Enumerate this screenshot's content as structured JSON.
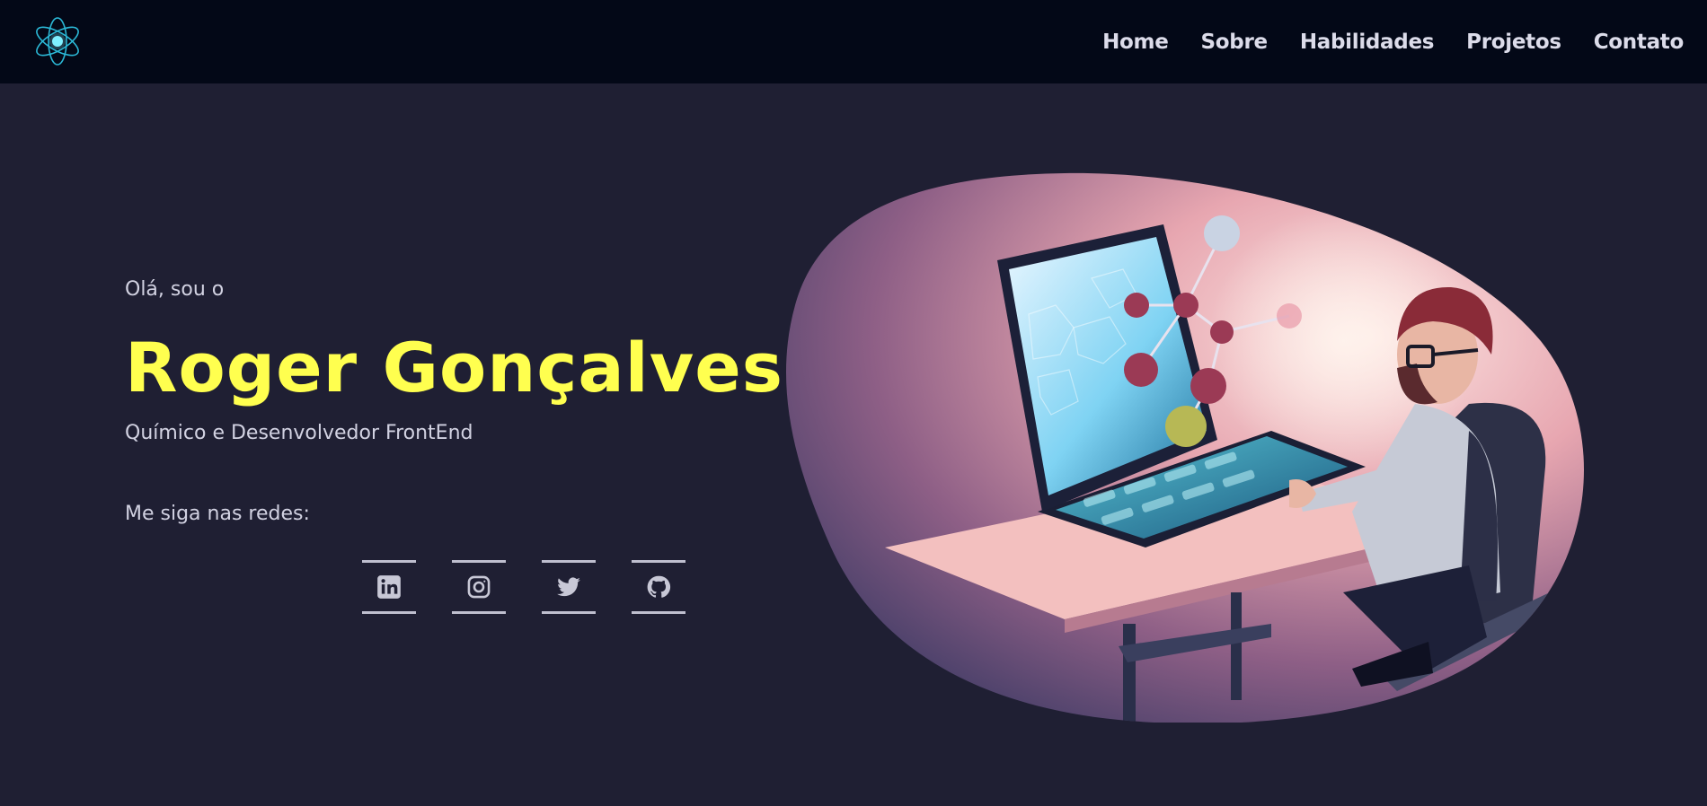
{
  "nav": {
    "logo": "atom-logo",
    "links": [
      "Home",
      "Sobre",
      "Habilidades",
      "Projetos",
      "Contato"
    ]
  },
  "hero": {
    "greeting": "Olá, sou o",
    "name": "Roger Gonçalves",
    "role": "Químico e Desenvolvedor FrontEnd",
    "follow_label": "Me siga nas redes:"
  },
  "socials": [
    "linkedin-icon",
    "instagram-icon",
    "twitter-icon",
    "github-icon"
  ],
  "colors": {
    "background": "#1f1f33",
    "navbar": "#030817",
    "name_accent": "#ffff4f",
    "text": "#d2d2e2"
  }
}
